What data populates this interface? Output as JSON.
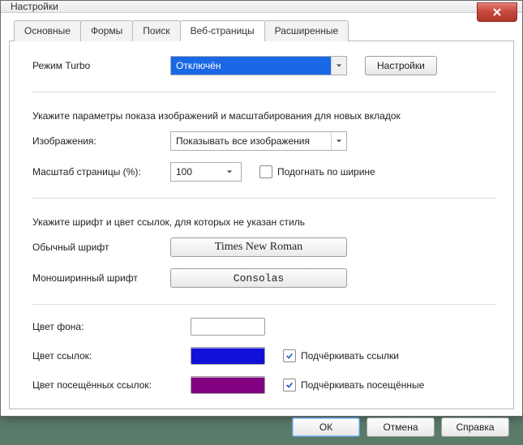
{
  "window": {
    "title": "Настройки"
  },
  "tabs": {
    "t0": "Основные",
    "t1": "Формы",
    "t2": "Поиск",
    "t3": "Веб-страницы",
    "t4": "Расширенные"
  },
  "turbo": {
    "label": "Режим Turbo",
    "value": "Отключён",
    "settings_btn": "Настройки"
  },
  "images_section": {
    "hint": "Укажите параметры показа изображений и масштабирования для новых вкладок",
    "images_label": "Изображения:",
    "images_value": "Показывать все изображения",
    "zoom_label": "Масштаб страницы (%):",
    "zoom_value": "100",
    "fit_width_label": "Подогнать по ширине"
  },
  "fonts_section": {
    "hint": "Укажите шрифт и цвет ссылок, для которых не указан стиль",
    "normal_label": "Обычный шрифт",
    "normal_value": "Times New Roman",
    "mono_label": "Моноширинный шрифт",
    "mono_value": "Consolas"
  },
  "colors_section": {
    "bg_label": "Цвет фона:",
    "link_label": "Цвет ссылок:",
    "visited_label": "Цвет посещённых ссылок:",
    "link_color": "#1010d8",
    "visited_color": "#800080",
    "bg_color": "#ffffff",
    "underline_links_label": "Подчёркивать ссылки",
    "underline_visited_label": "Подчёркивать посещённые"
  },
  "footer": {
    "ok": "ОК",
    "cancel": "Отмена",
    "help": "Справка"
  }
}
